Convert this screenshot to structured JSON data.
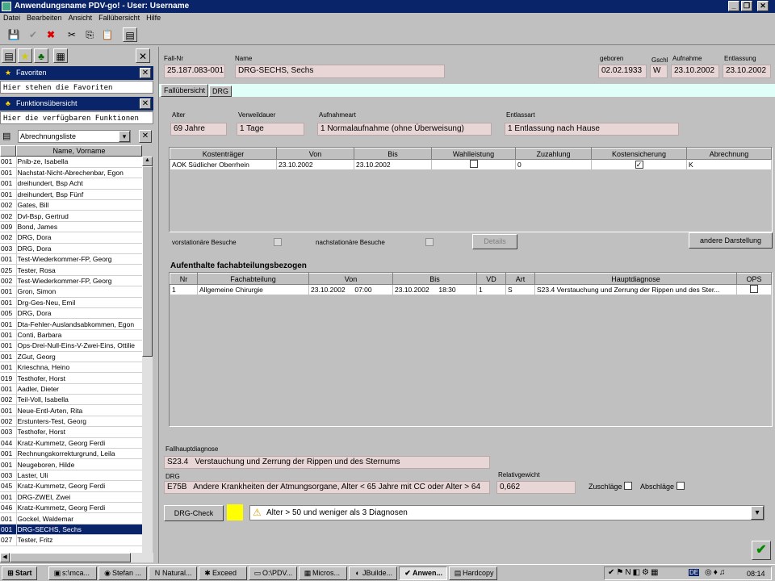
{
  "window": {
    "title": "Anwendungsname PDV-go! - User: Username"
  },
  "menu": [
    "Datei",
    "Bearbeiten",
    "Ansicht",
    "Fallübersicht",
    "Hilfe"
  ],
  "sidebar": {
    "favoriten_label": "Favoriten",
    "favoriten_text": "Hier stehen die Favoriten",
    "funktion_label": "Funktionsübersicht",
    "funktion_text": "Hier die verfügbaren Funktionen",
    "liste_select": "Abrechnungsliste",
    "col_name": "Name, Vorname",
    "rows": [
      [
        "001",
        "Pnib-ze, Isabella"
      ],
      [
        "001",
        "Nachstat-Nicht-Abrechenbar, Egon"
      ],
      [
        "001",
        "dreihundert, Bsp Acht"
      ],
      [
        "001",
        "dreihundert, Bsp Fünf"
      ],
      [
        "002",
        "Gates, Bill"
      ],
      [
        "002",
        "Dvl-Bsp, Gertrud"
      ],
      [
        "009",
        "Bond, James"
      ],
      [
        "002",
        "DRG, Dora"
      ],
      [
        "003",
        "DRG, Dora"
      ],
      [
        "001",
        "Test-Wiederkommer-FP, Georg"
      ],
      [
        "025",
        "Tester, Rosa"
      ],
      [
        "002",
        "Test-Wiederkommer-FP, Georg"
      ],
      [
        "001",
        "Gron, Simon"
      ],
      [
        "001",
        "Drg-Ges-Neu, Emil"
      ],
      [
        "005",
        "DRG, Dora"
      ],
      [
        "001",
        "Dta-Fehler-Auslandsabkommen, Egon"
      ],
      [
        "001",
        "Conti, Barbara"
      ],
      [
        "001",
        "Ops-Drei-Null-Eins-V-Zwei-Eins, Ottilie"
      ],
      [
        "001",
        "ZGut, Georg"
      ],
      [
        "001",
        "Krieschna, Heino"
      ],
      [
        "019",
        "Testhofer, Horst"
      ],
      [
        "001",
        "Aadler, Dieter"
      ],
      [
        "002",
        "Teil-Voll, Isabella"
      ],
      [
        "001",
        "Neue-Entl-Arten, Rita"
      ],
      [
        "002",
        "Erstunters-Test, Georg"
      ],
      [
        "003",
        "Testhofer, Horst"
      ],
      [
        "044",
        "Kratz-Kummetz, Georg Ferdi"
      ],
      [
        "001",
        "Rechnungskorrekturgrund, Leila"
      ],
      [
        "001",
        "Neugeboren, Hilde"
      ],
      [
        "003",
        "Laster, Uli"
      ],
      [
        "045",
        "Kratz-Kummetz, Georg Ferdi"
      ],
      [
        "001",
        "DRG-ZWEI, Zwei"
      ],
      [
        "046",
        "Kratz-Kummetz, Georg Ferdi"
      ],
      [
        "001",
        "Gockel, Waldemar"
      ],
      [
        "001",
        "DRG-SECHS, Sechs"
      ],
      [
        "027",
        "Tester, Fritz"
      ]
    ],
    "selected_index": 34
  },
  "header": {
    "fallnr_label": "Fall-Nr",
    "fallnr": "25.187.083-001",
    "name_label": "Name",
    "name": "DRG-SECHS, Sechs",
    "geboren_label": "geboren",
    "geboren": "02.02.1933",
    "gschl_label": "Gschl",
    "gschl": "W",
    "aufnahme_label": "Aufnahme",
    "aufnahme": "23.10.2002",
    "entlassung_label": "Entlassung",
    "entlassung": "23.10.2002"
  },
  "tabs": [
    "Fallübersicht",
    "DRG"
  ],
  "overview": {
    "alter_label": "Alter",
    "alter": "69 Jahre",
    "verweil_label": "Verweildauer",
    "verweil": "1 Tage",
    "aufnahmeart_label": "Aufnahmeart",
    "aufnahmeart": "1 Normalaufnahme (ohne Überweisung)",
    "entlassart_label": "Entlassart",
    "entlassart": "1 Entlassung nach Hause"
  },
  "kosten": {
    "headers": [
      "Kostenträger",
      "Von",
      "Bis",
      "Wahlleistung",
      "Zuzahlung",
      "Kostensicherung",
      "Abrechnung"
    ],
    "row": {
      "kostentraeger": "AOK Südlicher Oberrhein",
      "von": "23.10.2002",
      "bis": "23.10.2002",
      "zuzahlung": "0",
      "abrechnung": "K"
    }
  },
  "besuche": {
    "vor_label": "vorstationäre Besuche",
    "nach_label": "nachstationäre Besuche",
    "details_label": "Details",
    "andere_label": "andere Darstellung"
  },
  "aufenthalte": {
    "title": "Aufenthalte fachabteilungsbezogen",
    "headers": [
      "Nr",
      "Fachabteilung",
      "Von",
      "Bis",
      "VD",
      "Art",
      "Hauptdiagnose",
      "OPS"
    ],
    "row": {
      "nr": "1",
      "fach": "Allgemeine Chirurgie",
      "von": "23.10.2002     07:00",
      "bis": "23.10.2002     18:30",
      "vd": "1",
      "art": "S",
      "diag": "S23.4 Verstauchung und Zerrung der Rippen und des Ster..."
    }
  },
  "footer": {
    "fallhaupt_label": "Fallhauptdiagnose",
    "fallhaupt": "S23.4   Verstauchung und Zerrung der Rippen und des Sternums",
    "drg_label": "DRG",
    "drg": "E75B   Andere Krankheiten der Atmungsorgane, Alter < 65 Jahre mit CC oder Alter > 64",
    "relgew_label": "Relativgewicht",
    "relgew": "0,662",
    "zuschlaege_label": "Zuschläge",
    "abschlaege_label": "Abschläge",
    "drgcheck_label": "DRG-Check",
    "warning": "Alter > 50 und weniger als 3 Diagnosen"
  },
  "taskbar": {
    "start": "Start",
    "tasks": [
      "s:\\mca...",
      "Stefan ...",
      "Natural...",
      "Exceed",
      "O:\\PDV...",
      "Micros...",
      "JBuilde...",
      "Anwen...",
      "Hardcopy"
    ],
    "lang": "DE",
    "time": "08:14"
  },
  "colors": {
    "titlebar": "#0a246a",
    "field": "#e8d6d6",
    "warning_yellow": "#ffff00",
    "selected": "#0a246a"
  }
}
